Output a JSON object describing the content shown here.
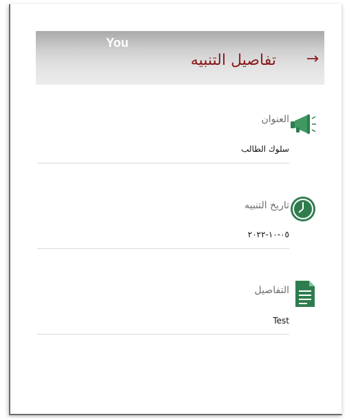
{
  "header": {
    "you_label": "You",
    "title": "تفاصيل التنبيه",
    "back_arrow": "→"
  },
  "fields": [
    {
      "label": "العنوان",
      "value": "سلوك الطالب",
      "icon": "megaphone-icon"
    },
    {
      "label": "تاريخ التنبيه",
      "value": "٠٥-١٠-٢٠٢٢",
      "icon": "clock-icon"
    },
    {
      "label": "التفاصيل",
      "value": "Test",
      "icon": "document-icon"
    }
  ],
  "colors": {
    "accent": "#8a1a1a",
    "icon_green": "#2f7d4f"
  }
}
